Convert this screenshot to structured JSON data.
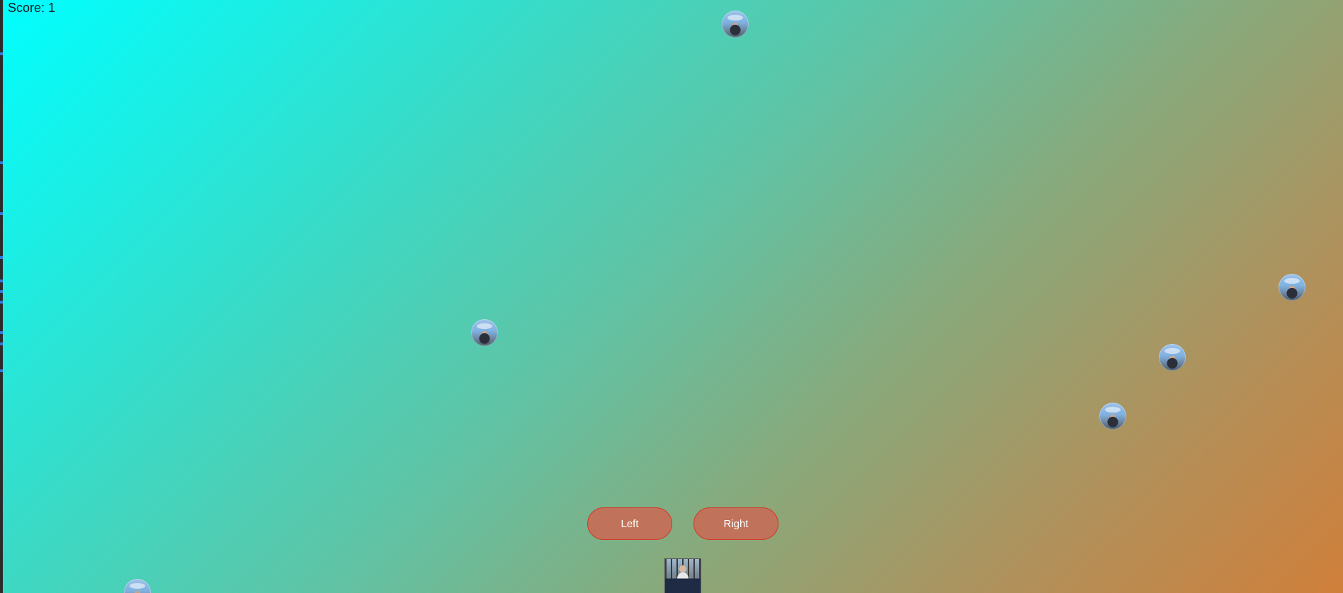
{
  "game": {
    "score_text": "Score: 1"
  },
  "controls": {
    "left_label": "Left",
    "right_label": "Right"
  },
  "colors": {
    "background_start": "#00ffff",
    "background_end": "#d07f3a",
    "button_fill": "#c0735a",
    "button_border": "#d23a2a",
    "button_text": "#ffffff"
  },
  "items": {
    "falling_item_icon": "circular-photo-ball-icon",
    "player_icon": "player-photo-icon"
  }
}
